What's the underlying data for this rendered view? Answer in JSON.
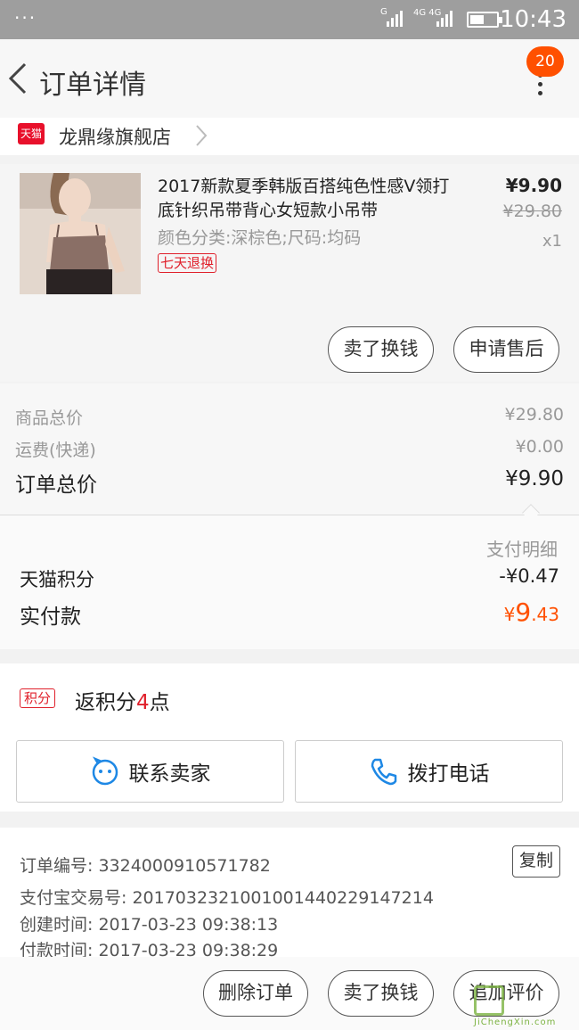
{
  "status_bar": {
    "time": "10:43",
    "sim1_label": "G",
    "sim2_label": "4G 4G",
    "battery_level": 0.55
  },
  "header": {
    "title": "订单详情",
    "notification_count": "20"
  },
  "shop": {
    "logo_text": "天猫",
    "name": "龙鼎缘旗舰店"
  },
  "product": {
    "name": "2017新款夏季韩版百搭纯色性感V领打底针织吊带背心女短款小吊带",
    "spec": "颜色分类:深棕色;尺码:均码",
    "tag": "七天退换",
    "price": "¥9.90",
    "original_price": "¥29.80",
    "quantity": "x1",
    "actions": [
      "卖了换钱",
      "申请售后"
    ]
  },
  "totals": {
    "goods_label": "商品总价",
    "goods_value": "¥29.80",
    "shipping_label": "运费(快递)",
    "shipping_value": "¥0.00",
    "order_label": "订单总价",
    "order_value": "¥9.90"
  },
  "payment": {
    "detail_link": "支付明细",
    "points_label": "天猫积分",
    "points_value": "-¥0.47",
    "paid_label": "实付款",
    "paid_currency": "¥",
    "paid_int": "9",
    "paid_dec": ".43"
  },
  "rewards": {
    "tag": "积分",
    "text_prefix": "返积分",
    "points": "4",
    "text_suffix": "点",
    "contact_seller": "联系卖家",
    "call_phone": "拨打电话"
  },
  "order_info": {
    "order_no": "订单编号: 3324000910571782",
    "copy": "复制",
    "alipay_no": "支付宝交易号: 2017032321001001440229147214",
    "created": "创建时间: 2017-03-23 09:38:13",
    "paid_time": "付款时间: 2017-03-23 09:38:29"
  },
  "bottom_bar": {
    "delete_order": "删除订单",
    "sell": "卖了换钱",
    "review": "追加评价"
  },
  "watermark": {
    "text": "JiChengXin.com"
  },
  "colors": {
    "accent": "#ff5000",
    "tmall_red": "#e0202b",
    "link_blue": "#1e88e5"
  }
}
